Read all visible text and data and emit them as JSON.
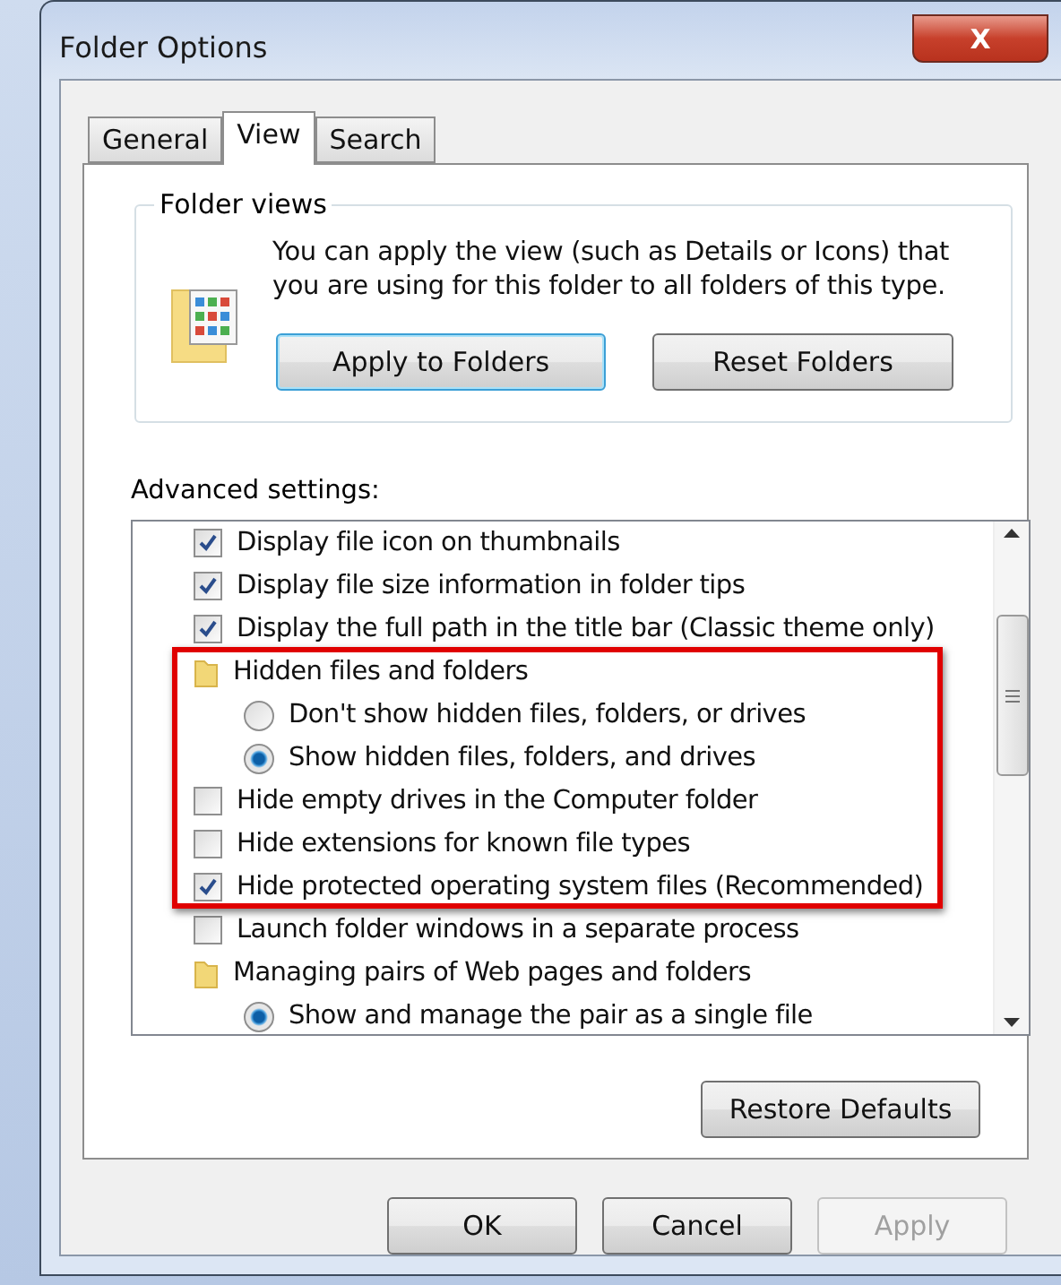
{
  "window": {
    "title": "Folder Options",
    "close_label": "X"
  },
  "tabs": [
    {
      "label": "General",
      "selected": false
    },
    {
      "label": "View",
      "selected": true
    },
    {
      "label": "Search",
      "selected": false
    }
  ],
  "folder_views": {
    "title": "Folder views",
    "description": "You can apply the view (such as Details or Icons) that you are using for this folder to all folders of this type.",
    "buttons": [
      {
        "label": "Apply to Folders",
        "focused": true
      },
      {
        "label": "Reset Folders",
        "focused": false
      }
    ]
  },
  "advanced": {
    "label": "Advanced settings:",
    "items": [
      {
        "kind": "checkbox",
        "label": "Display file icon on thumbnails",
        "checked": true
      },
      {
        "kind": "checkbox",
        "label": "Display file size information in folder tips",
        "checked": true
      },
      {
        "kind": "checkbox",
        "label": "Display the full path in the title bar (Classic theme only)",
        "checked": true
      },
      {
        "kind": "folder",
        "label": "Hidden files and folders",
        "children": [
          {
            "kind": "radio",
            "label": "Don't show hidden files, folders, or drives",
            "selected": false
          },
          {
            "kind": "radio",
            "label": "Show hidden files, folders, and drives",
            "selected": true
          }
        ]
      },
      {
        "kind": "checkbox",
        "label": "Hide empty drives in the Computer folder",
        "checked": false
      },
      {
        "kind": "checkbox",
        "label": "Hide extensions for known file types",
        "checked": false
      },
      {
        "kind": "checkbox",
        "label": "Hide protected operating system files (Recommended)",
        "checked": true
      },
      {
        "kind": "checkbox",
        "label": "Launch folder windows in a separate process",
        "checked": false
      },
      {
        "kind": "folder",
        "label": "Managing pairs of Web pages and folders",
        "children": [
          {
            "kind": "radio",
            "label": "Show and manage the pair as a single file",
            "selected": true
          }
        ]
      }
    ],
    "restore_button": "Restore Defaults"
  },
  "footer_buttons": [
    {
      "label": "OK",
      "disabled": false
    },
    {
      "label": "Cancel",
      "disabled": false
    },
    {
      "label": "Apply",
      "disabled": true
    }
  ]
}
